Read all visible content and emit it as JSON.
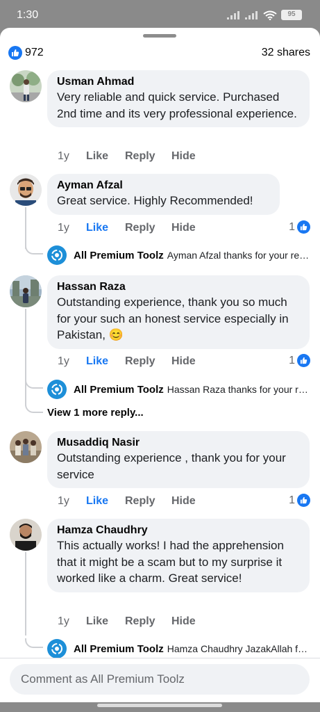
{
  "status_bar": {
    "time": "1:30",
    "battery": "95"
  },
  "summary": {
    "like_count": "972",
    "shares": "32 shares"
  },
  "comments": [
    {
      "name": "Usman Ahmad",
      "text": "Very reliable and quick service. Purchased 2nd time and its very professional experience.",
      "time": "1y",
      "like": "Like",
      "reply": "Reply",
      "hide": "Hide"
    },
    {
      "name": "Ayman Afzal",
      "text": "Great service. Highly Recommended!",
      "time": "1y",
      "like": "Like",
      "reply": "Reply",
      "hide": "Hide",
      "reactions": "1",
      "page_reply": {
        "name": "All Premium Toolz",
        "text": "Ayman Afzal thanks for your review"
      }
    },
    {
      "name": "Hassan Raza",
      "text": "Outstanding experience, thank you so much for your such an honest service especially in Pakistan, 😊",
      "time": "1y",
      "like": "Like",
      "reply": "Reply",
      "hide": "Hide",
      "reactions": "1",
      "page_reply": {
        "name": "All Premium Toolz",
        "text": "Hassan Raza thanks for your review"
      },
      "view_more": "View 1 more reply..."
    },
    {
      "name": "Musaddiq Nasir",
      "text": "Outstanding experience , thank you for your service",
      "time": "1y",
      "like": "Like",
      "reply": "Reply",
      "hide": "Hide",
      "reactions": "1"
    },
    {
      "name": "Hamza Chaudhry",
      "text": "This actually works! I had the apprehension that it might be a scam but to my surprise it worked like a charm. Great service!",
      "time": "1y",
      "like": "Like",
      "reply": "Reply",
      "hide": "Hide",
      "page_reply": {
        "name": "All Premium Toolz",
        "text": "Hamza Chaudhry JazakAllah for your review"
      }
    }
  ],
  "composer": {
    "placeholder": "Comment as All Premium Toolz"
  },
  "colors": {
    "accent": "#1877f2",
    "bubble": "#f0f2f5",
    "muted": "#65676b"
  }
}
